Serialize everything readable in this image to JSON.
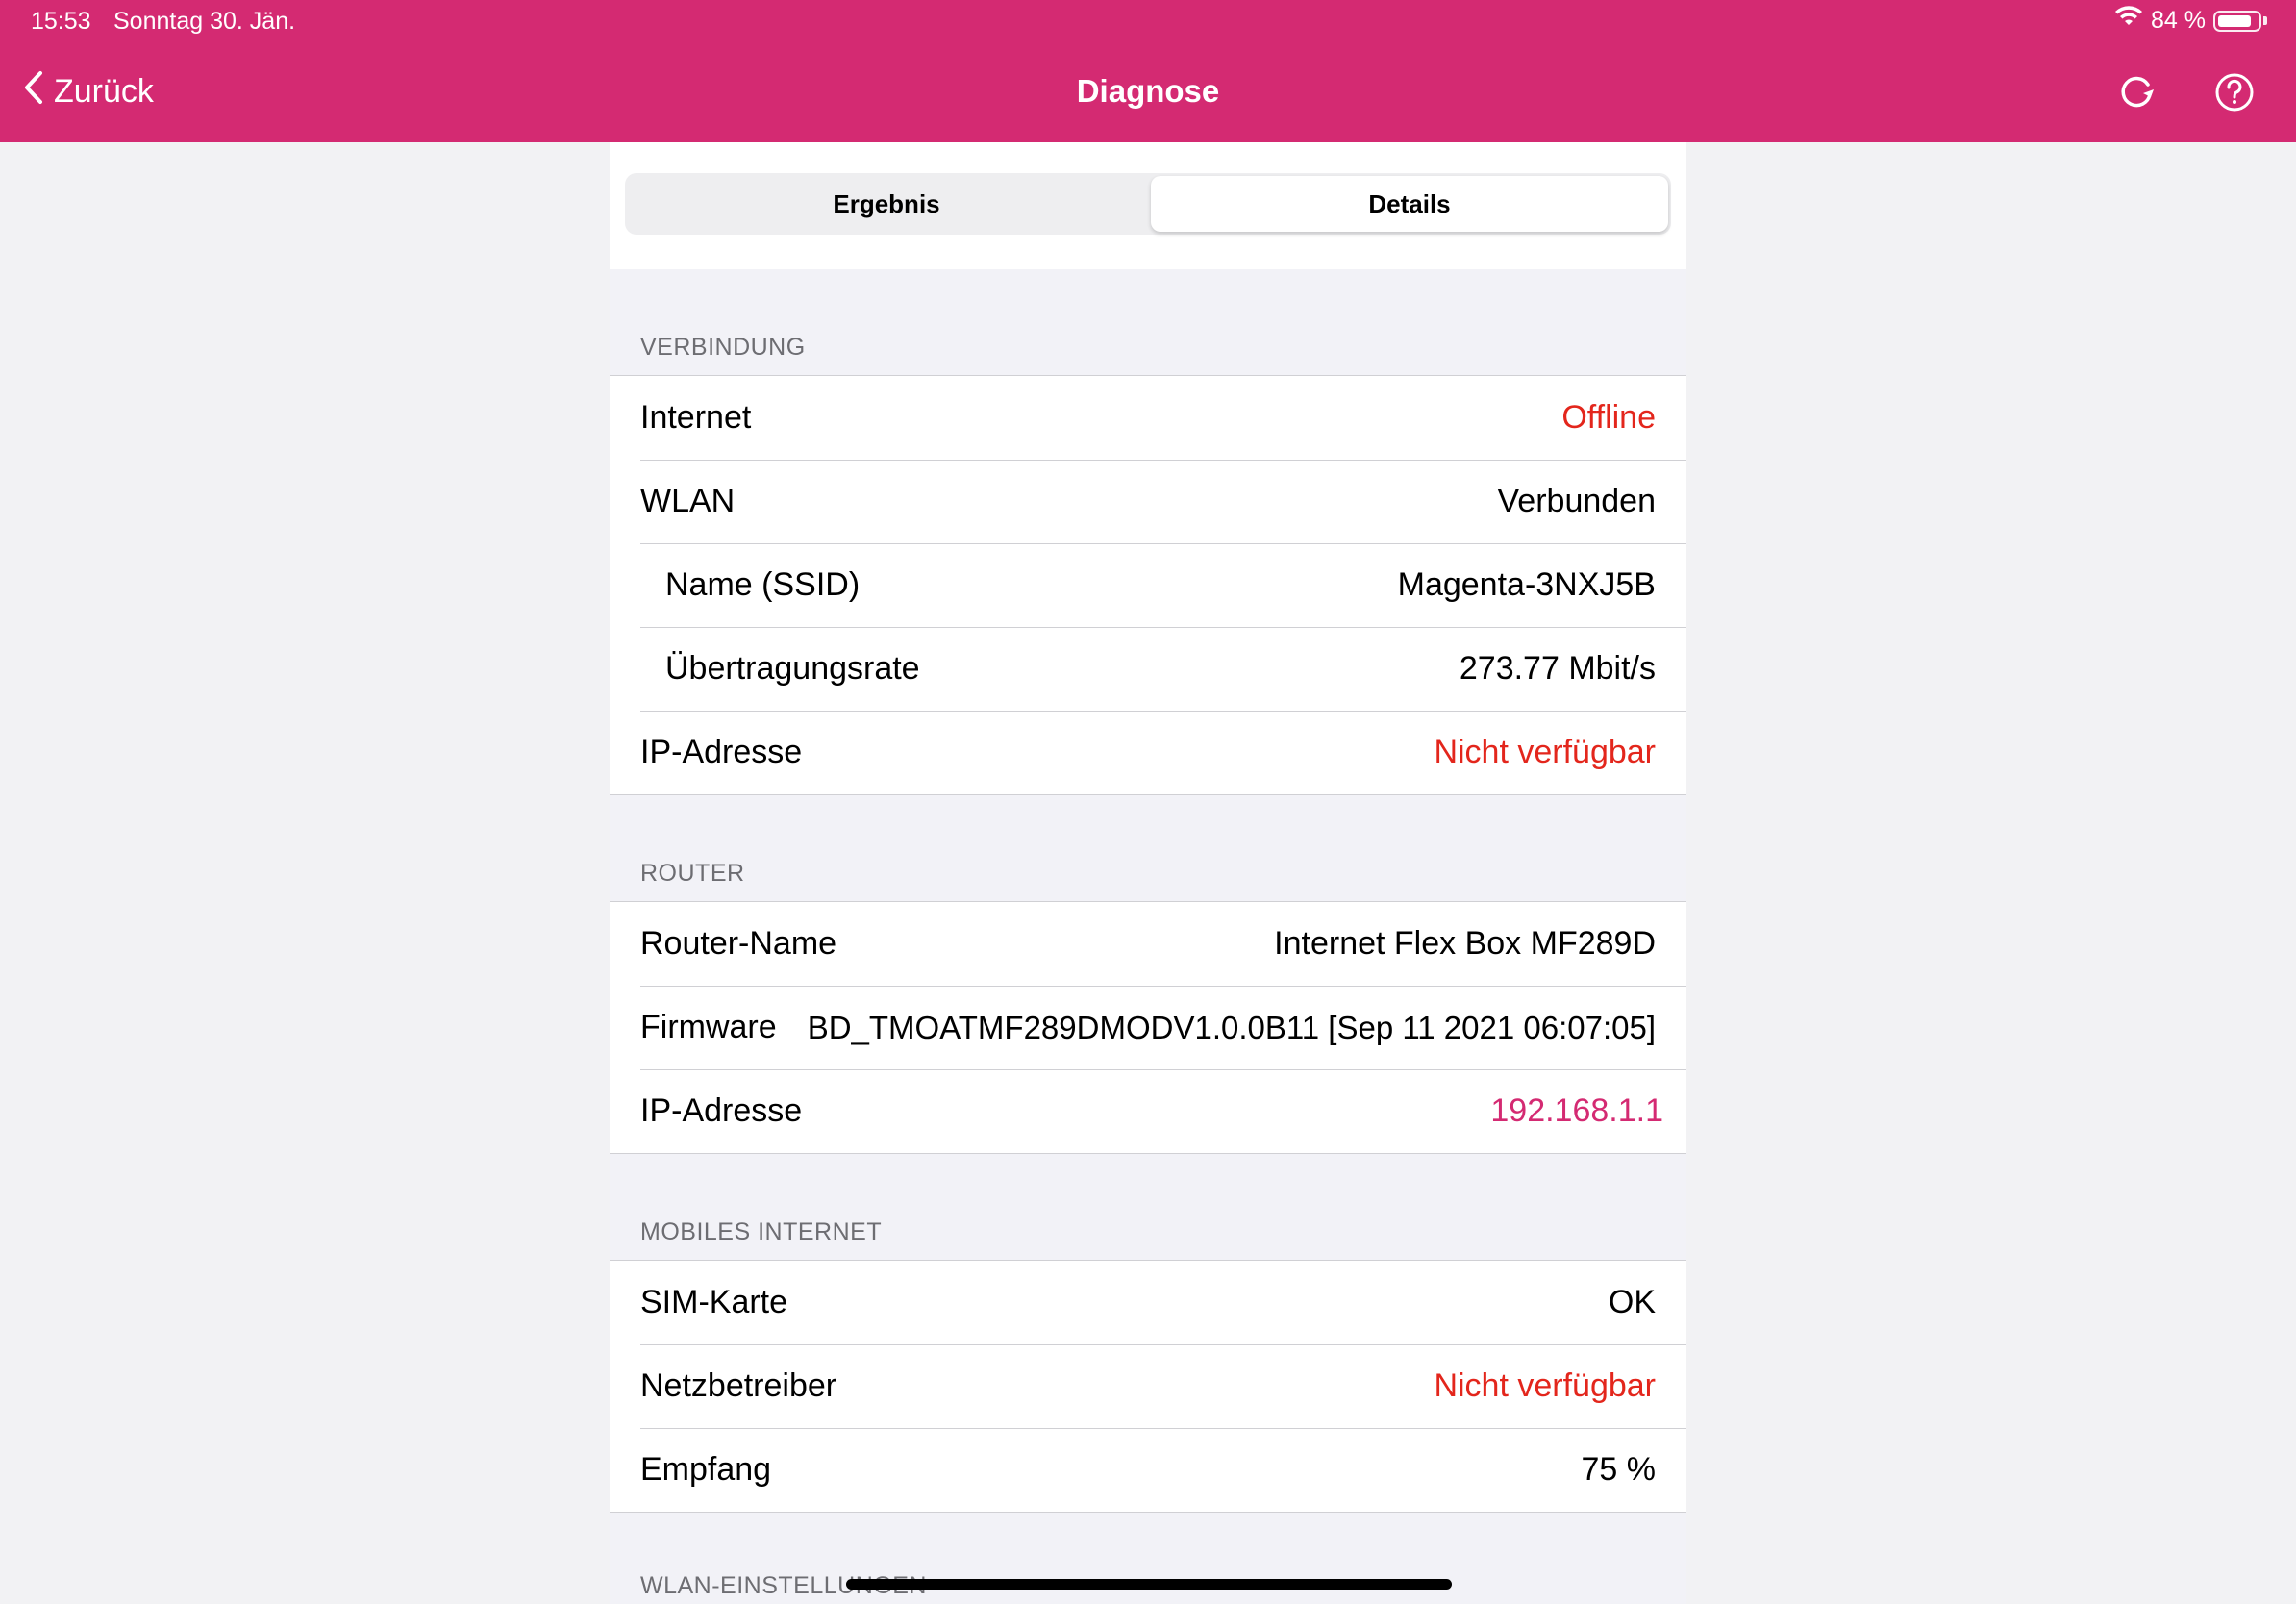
{
  "status": {
    "time": "15:53",
    "date": "Sonntag 30. Jän.",
    "battery": "84 %",
    "battery_level": 0.84
  },
  "nav": {
    "back_label": "Zurück",
    "title": "Diagnose"
  },
  "segments": {
    "left": "Ergebnis",
    "right": "Details",
    "selected": "Details"
  },
  "sections": {
    "verbindung": {
      "header": "VERBINDUNG",
      "rows": [
        {
          "label": "Internet",
          "value": "Offline"
        },
        {
          "label": "WLAN",
          "value": "Verbunden"
        },
        {
          "label": "Name (SSID)",
          "value": "Magenta-3NXJ5B"
        },
        {
          "label": "Übertragungsrate",
          "value": "273.77 Mbit/s"
        },
        {
          "label": "IP-Adresse",
          "value": "Nicht verfügbar"
        }
      ]
    },
    "router": {
      "header": "ROUTER",
      "rows": [
        {
          "label": "Router-Name",
          "value": "Internet Flex Box MF289D"
        },
        {
          "label": "Firmware",
          "value": "BD_TMOATMF289DMODV1.0.0B11 [Sep 11 2021 06:07:05]"
        },
        {
          "label": "IP-Adresse",
          "value": "192.168.1.1"
        }
      ]
    },
    "mobil": {
      "header": "MOBILES INTERNET",
      "rows": [
        {
          "label": "SIM-Karte",
          "value": "OK"
        },
        {
          "label": "Netzbetreiber",
          "value": "Nicht verfügbar"
        },
        {
          "label": "Empfang",
          "value": "75 %"
        }
      ]
    },
    "wlan_einstellungen": {
      "header": "WLAN-EINSTELLUNGEN"
    }
  },
  "colors": {
    "brand": "#d42a72",
    "error": "#e3261c",
    "link": "#d42a72"
  },
  "icons": [
    "wifi-icon",
    "battery-icon",
    "chevron-left-icon",
    "refresh-icon",
    "help-icon"
  ]
}
